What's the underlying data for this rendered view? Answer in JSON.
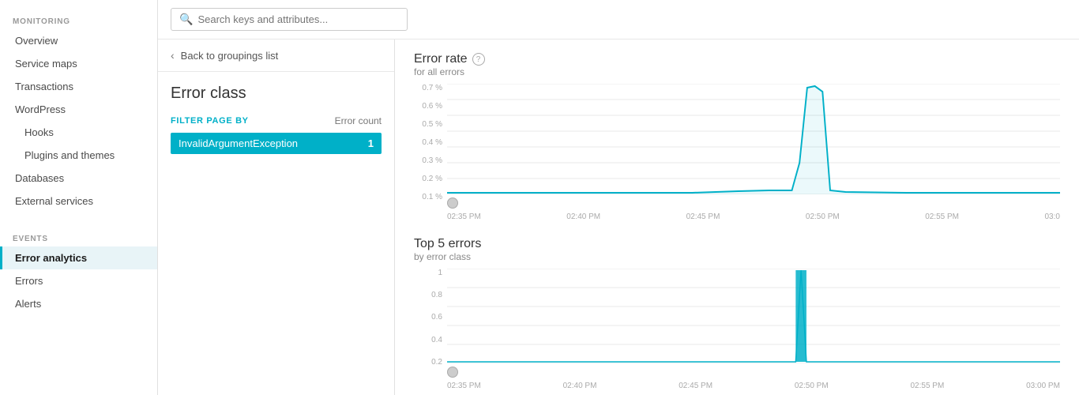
{
  "sidebar": {
    "monitoring_label": "MONITORING",
    "events_label": "EVENTS",
    "items_monitoring": [
      {
        "id": "overview",
        "label": "Overview",
        "sub": false,
        "active": false
      },
      {
        "id": "service-maps",
        "label": "Service maps",
        "sub": false,
        "active": false
      },
      {
        "id": "transactions",
        "label": "Transactions",
        "sub": false,
        "active": false
      },
      {
        "id": "wordpress",
        "label": "WordPress",
        "sub": false,
        "active": false
      },
      {
        "id": "hooks",
        "label": "Hooks",
        "sub": true,
        "active": false
      },
      {
        "id": "plugins-themes",
        "label": "Plugins and themes",
        "sub": true,
        "active": false
      },
      {
        "id": "databases",
        "label": "Databases",
        "sub": false,
        "active": false
      },
      {
        "id": "external-services",
        "label": "External services",
        "sub": false,
        "active": false
      }
    ],
    "items_events": [
      {
        "id": "error-analytics",
        "label": "Error analytics",
        "sub": false,
        "active": true
      },
      {
        "id": "errors",
        "label": "Errors",
        "sub": false,
        "active": false
      },
      {
        "id": "alerts",
        "label": "Alerts",
        "sub": false,
        "active": false
      }
    ]
  },
  "topbar": {
    "search_placeholder": "Search keys and attributes..."
  },
  "left_panel": {
    "back_label": "Back to groupings list",
    "title": "Error class",
    "filter_label": "FILTER PAGE BY",
    "error_count_label": "Error count",
    "filter_item": "InvalidArgumentException",
    "filter_count": "1"
  },
  "error_rate_chart": {
    "title": "Error rate",
    "subtitle": "for all errors",
    "y_labels": [
      "0.7 %",
      "0.6 %",
      "0.5 %",
      "0.4 %",
      "0.3 %",
      "0.2 %",
      "0.1 %",
      ""
    ],
    "x_labels": [
      "02:35 PM",
      "02:40 PM",
      "02:45 PM",
      "02:50 PM",
      "02:55 PM",
      "03:0"
    ]
  },
  "top5_chart": {
    "title": "Top 5 errors",
    "subtitle": "by error class",
    "y_labels": [
      "1",
      "0.8",
      "0.6",
      "0.4",
      "0.2",
      ""
    ],
    "x_labels": [
      "02:35 PM",
      "02:40 PM",
      "02:45 PM",
      "02:50 PM",
      "02:55 PM",
      "03:00 PM"
    ]
  },
  "colors": {
    "accent": "#00b0c8",
    "sidebar_active_bg": "#e8f4f7",
    "sidebar_active_border": "#00b0c8"
  }
}
